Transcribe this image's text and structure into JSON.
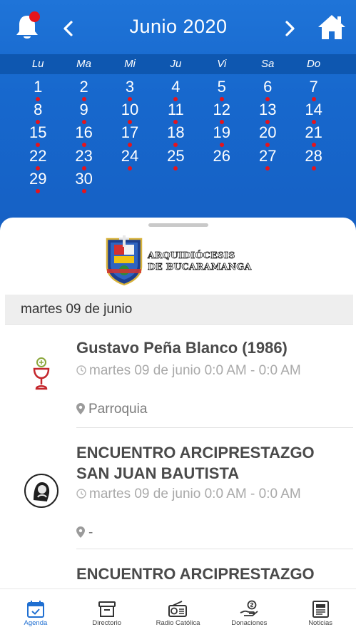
{
  "colors": {
    "primary": "#1768cd",
    "weekday_bar": "#0e57b0",
    "event_dot": "#e5141c",
    "tab_active": "#1f6fd1"
  },
  "calendar": {
    "month_label": "Junio 2020",
    "weekdays": [
      "Lu",
      "Ma",
      "Mi",
      "Ju",
      "Vi",
      "Sa",
      "Do"
    ],
    "days": [
      {
        "n": "1",
        "dot": true
      },
      {
        "n": "2",
        "dot": true
      },
      {
        "n": "3",
        "dot": true
      },
      {
        "n": "4",
        "dot": true
      },
      {
        "n": "5",
        "dot": true
      },
      {
        "n": "6",
        "dot": true
      },
      {
        "n": "7",
        "dot": true
      },
      {
        "n": "8",
        "dot": true
      },
      {
        "n": "9",
        "dot": true
      },
      {
        "n": "10",
        "dot": true
      },
      {
        "n": "11",
        "dot": true
      },
      {
        "n": "12",
        "dot": true
      },
      {
        "n": "13",
        "dot": true
      },
      {
        "n": "14",
        "dot": true
      },
      {
        "n": "15",
        "dot": true
      },
      {
        "n": "16",
        "dot": true
      },
      {
        "n": "17",
        "dot": true
      },
      {
        "n": "18",
        "dot": true
      },
      {
        "n": "19",
        "dot": true
      },
      {
        "n": "20",
        "dot": true
      },
      {
        "n": "21",
        "dot": true
      },
      {
        "n": "22",
        "dot": true
      },
      {
        "n": "23",
        "dot": true
      },
      {
        "n": "24",
        "dot": true
      },
      {
        "n": "25",
        "dot": true
      },
      {
        "n": "26",
        "dot": false
      },
      {
        "n": "27",
        "dot": true
      },
      {
        "n": "28",
        "dot": true
      },
      {
        "n": "29",
        "dot": true
      },
      {
        "n": "30",
        "dot": true
      }
    ],
    "icons": {
      "bell": "bell-icon",
      "prev": "chevron-left-icon",
      "next": "chevron-right-icon",
      "home": "home-icon"
    }
  },
  "logo": {
    "line1": "ARQUIDIÓCESIS",
    "line2": "DE BUCARAMANGA"
  },
  "selected_date": "martes 09 de junio",
  "events": [
    {
      "title": "Gustavo Peña Blanco (1986)",
      "time": "martes 09 de junio 0:0 AM - 0:0 AM",
      "place": "Parroquia",
      "icon": "chalice-icon"
    },
    {
      "title": "ENCUENTRO ARCIPRESTAZGO SAN JUAN BAUTISTA",
      "time": "martes 09 de junio 0:0 AM - 0:0 AM",
      "place": "-",
      "icon": "saint-portrait-icon"
    },
    {
      "title": "ENCUENTRO ARCIPRESTAZGO",
      "time": "",
      "place": "",
      "icon": ""
    }
  ],
  "tabs": [
    {
      "label": "Agenda",
      "icon": "calendar-icon",
      "active": true
    },
    {
      "label": "Directorio",
      "icon": "archive-box-icon",
      "active": false
    },
    {
      "label": "Radio Católica",
      "icon": "radio-icon",
      "active": false
    },
    {
      "label": "Donaciones",
      "icon": "donation-hand-icon",
      "active": false
    },
    {
      "label": "Noticias",
      "icon": "newspaper-icon",
      "active": false
    }
  ]
}
